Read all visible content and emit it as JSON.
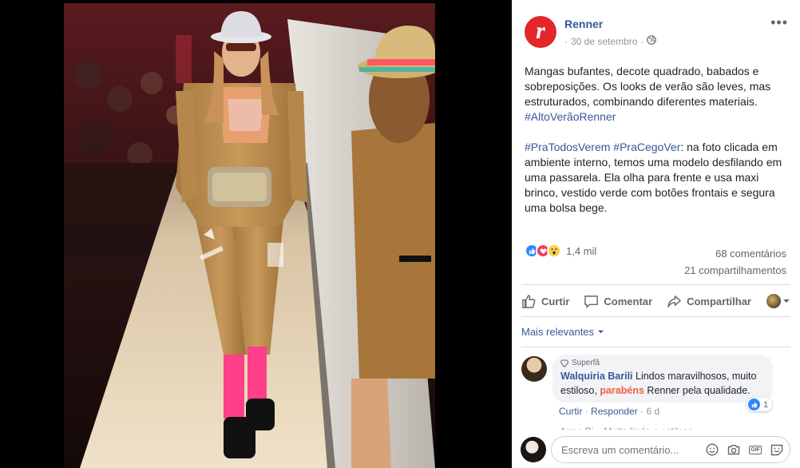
{
  "post": {
    "page_name": "Renner",
    "logo_letter": "r",
    "date": "30 de setembro",
    "separator": "·",
    "privacy_icon": "globe-icon",
    "more_label": "•••",
    "text_p1": "Mangas bufantes, decote quadrado, babados e sobreposições. Os looks de verão são leves, mas estruturados, combinando diferentes materiais.",
    "hashtag1": "#AltoVerãoRenner",
    "hashtag2": "#PraTodosVerem",
    "hashtag3": "#PraCegoVer",
    "text_p2": ": na foto clicada em ambiente interno, temos uma modelo desfilando em uma passarela. Ela olha para frente e usa maxi brinco, vestido verde com botões frontais e segura uma bolsa bege."
  },
  "reactions": {
    "icons": [
      "like-icon",
      "love-icon",
      "wow-icon"
    ],
    "count": "1,4 mil",
    "comments": "68 comentários",
    "shares": "21 compartilhamentos"
  },
  "actions": {
    "like": "Curtir",
    "comment": "Comentar",
    "share": "Compartilhar"
  },
  "sort": {
    "label": "Mais relevantes"
  },
  "comment": {
    "badge": "Superfã",
    "author": "Walquiria Barili",
    "text_a": " Lindos maravilhosos, muito estiloso, ",
    "highlight": "parabéns",
    "text_b": " Renner pela qualidade.",
    "like_count": "1",
    "like": "Curtir",
    "reply": "Responder",
    "time": "6 d",
    "next_comment_partial": "Anne Bi... Muito lindo e estilosa"
  },
  "composer": {
    "placeholder": "Escreva um comentário...",
    "icons": [
      "emoji-icon",
      "camera-icon",
      "gif-icon",
      "sticker-icon"
    ]
  },
  "colors": {
    "brand_red": "#e3262b",
    "link": "#365899",
    "highlight": "#f25d42",
    "like_blue": "#2d88ff"
  }
}
